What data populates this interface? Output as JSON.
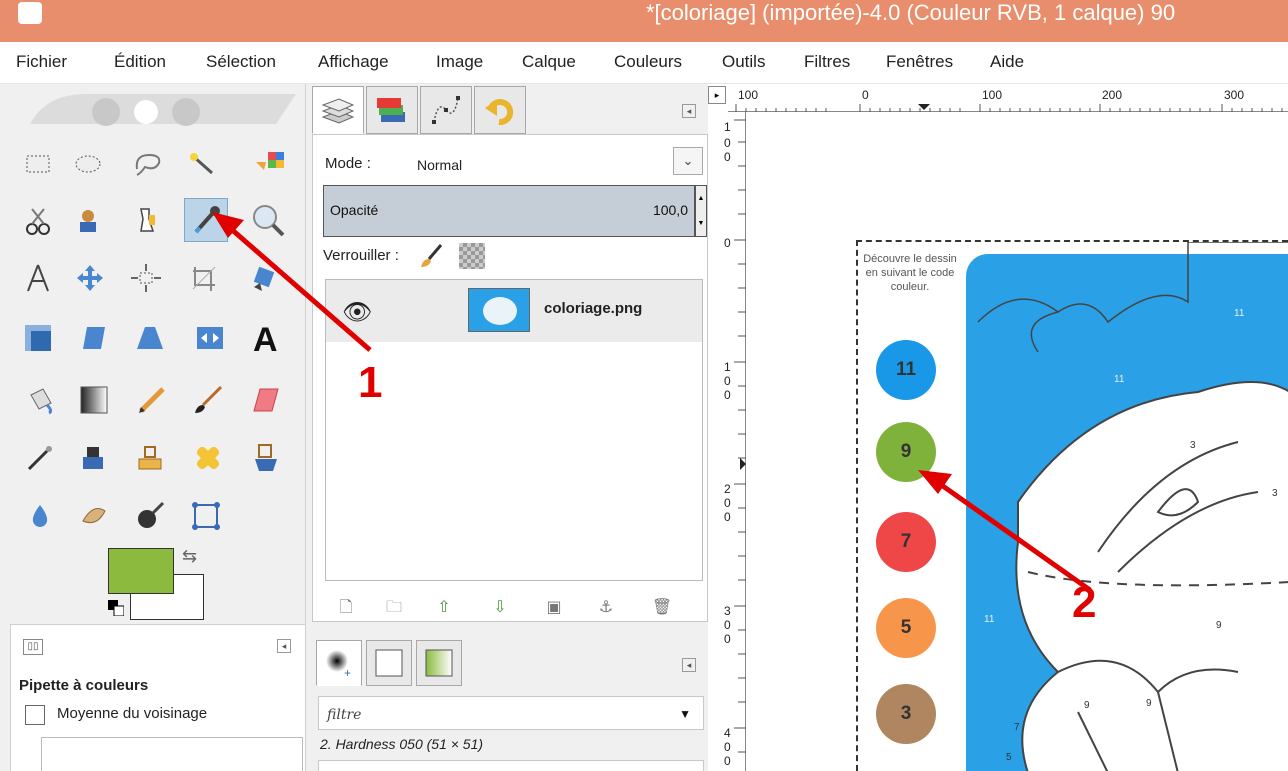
{
  "window": {
    "title": "*[coloriage] (importée)-4.0 (Couleur RVB, 1 calque) 90",
    "titlebar_color": "#e98e6c"
  },
  "menubar": {
    "items": [
      {
        "label": "Fichier"
      },
      {
        "label": "Édition"
      },
      {
        "label": "Sélection"
      },
      {
        "label": "Affichage"
      },
      {
        "label": "Image"
      },
      {
        "label": "Calque"
      },
      {
        "label": "Couleurs"
      },
      {
        "label": "Outils"
      },
      {
        "label": "Filtres"
      },
      {
        "label": "Fenêtres"
      },
      {
        "label": "Aide"
      }
    ]
  },
  "toolbox": {
    "foreground_color": "#8cba3e",
    "background_color": "#ffffff",
    "active_tool": "color-picker"
  },
  "tool_options": {
    "title": "Pipette à couleurs",
    "option_label": "Moyenne du voisinage",
    "option_checked": false
  },
  "layers": {
    "mode_label": "Mode :",
    "mode_value": "Normal",
    "opacity_label": "Opacité",
    "opacity_value": "100,0",
    "lock_label": "Verrouiller :",
    "layer_name": "coloriage.png"
  },
  "brushes": {
    "filter_placeholder": "filtre",
    "brush_name": "2. Hardness 050 (51 × 51)"
  },
  "ruler": {
    "h_labels": [
      "100",
      "0",
      "100",
      "200",
      "300"
    ],
    "v_labels": [
      "1",
      "0",
      "0",
      "0",
      "1",
      "0",
      "0",
      "2",
      "0",
      "0",
      "3",
      "0",
      "0",
      "4",
      "0",
      "0"
    ]
  },
  "image": {
    "intro_text": "Découvre le dessin en suivant le code couleur.",
    "legend": [
      {
        "number": "11",
        "color": "#1a98e8"
      },
      {
        "number": "9",
        "color": "#7fb23a"
      },
      {
        "number": "7",
        "color": "#ef4747"
      },
      {
        "number": "5",
        "color": "#f7964a"
      },
      {
        "number": "3",
        "color": "#b08660"
      }
    ],
    "region_numbers": [
      "11",
      "11",
      "3",
      "3",
      "9",
      "9",
      "7",
      "9",
      "5",
      "11"
    ]
  },
  "annotations": [
    {
      "label": "1"
    },
    {
      "label": "2"
    }
  ]
}
